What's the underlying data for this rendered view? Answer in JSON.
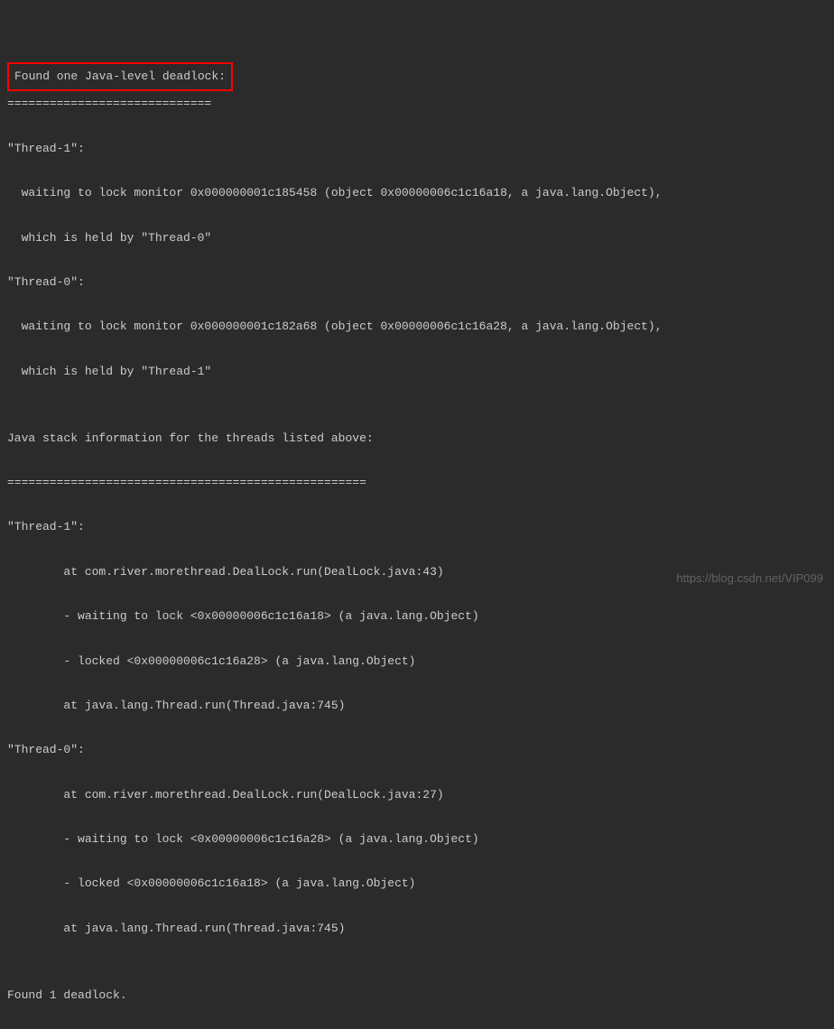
{
  "terminal": {
    "line1": "Found one Java-level deadlock:",
    "line2": "=============================",
    "line3": "\"Thread-1\":",
    "line4": "  waiting to lock monitor 0x000000001c185458 (object 0x00000006c1c16a18, a java.lang.Object),",
    "line5": "  which is held by \"Thread-0\"",
    "line6": "\"Thread-0\":",
    "line7": "  waiting to lock monitor 0x000000001c182a68 (object 0x00000006c1c16a28, a java.lang.Object),",
    "line8": "  which is held by \"Thread-1\"",
    "line9": "",
    "line10": "Java stack information for the threads listed above:",
    "line11": "===================================================",
    "line12": "\"Thread-1\":",
    "line13": "        at com.river.morethread.DealLock.run(DealLock.java:43)",
    "line14": "        - waiting to lock <0x00000006c1c16a18> (a java.lang.Object)",
    "line15": "        - locked <0x00000006c1c16a28> (a java.lang.Object)",
    "line16": "        at java.lang.Thread.run(Thread.java:745)",
    "line17": "\"Thread-0\":",
    "line18": "        at com.river.morethread.DealLock.run(DealLock.java:27)",
    "line19": "        - waiting to lock <0x00000006c1c16a28> (a java.lang.Object)",
    "line20": "        - locked <0x00000006c1c16a18> (a java.lang.Object)",
    "line21": "        at java.lang.Thread.run(Thread.java:745)",
    "line22": "",
    "line23": "Found 1 deadlock."
  },
  "watermark": "https://blog.csdn.net/VIP099"
}
